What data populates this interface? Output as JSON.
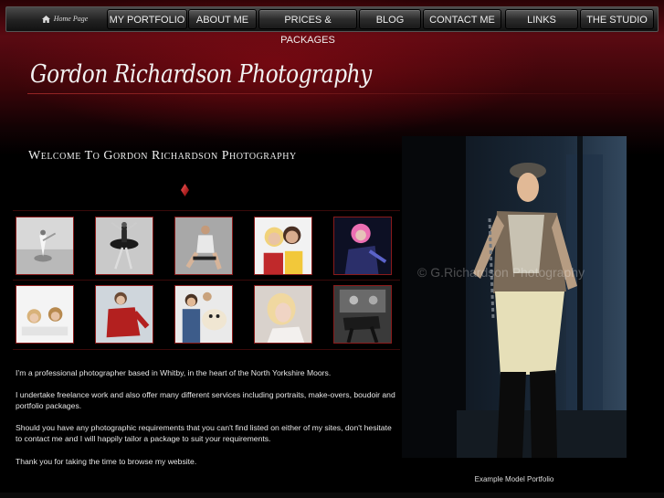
{
  "nav": {
    "home_label": "Home Page",
    "items": [
      {
        "label": "MY PORTFOLIO"
      },
      {
        "label": "ABOUT ME"
      },
      {
        "label": "PRICES & PACKAGES"
      },
      {
        "label": "BLOG"
      },
      {
        "label": "CONTACT ME"
      },
      {
        "label": "LINKS"
      },
      {
        "label": "THE STUDIO"
      }
    ]
  },
  "header": {
    "site_title": "Gordon Richardson Photography"
  },
  "main": {
    "welcome_heading": "Welcome To Gordon Richardson Photography",
    "thumbnails": [
      {
        "icon": "ballet-dancer-beach-photo"
      },
      {
        "icon": "ballerina-tutu-photo"
      },
      {
        "icon": "seated-model-photo"
      },
      {
        "icon": "two-blonde-women-photo"
      },
      {
        "icon": "pink-hair-model-photo"
      },
      {
        "icon": "two-girls-lying-photo"
      },
      {
        "icon": "red-jumper-model-photo"
      },
      {
        "icon": "couple-with-dog-photo"
      },
      {
        "icon": "blonde-portrait-photo"
      },
      {
        "icon": "mirror-boudoir-photo"
      }
    ],
    "paragraphs": [
      "I’m a professional photographer based in Whitby, in the heart of the North Yorkshire Moors.",
      "I undertake freelance work and also offer many different services including portraits, make-overs, boudoir and portfolio packages.",
      "Should you have any photographic requirements that you can't find listed on either of my sites, don't hesitate to contact me and I will happily tailor a package to suit your requirements.",
      "Thank you for taking the time to browse my website."
    ]
  },
  "feature": {
    "image_icon": "model-in-doorway-photo",
    "watermark": "© G.Richardson Photography",
    "caption": "Example Model Portfolio"
  },
  "colors": {
    "accent_red": "#8a1b1b",
    "nav_text": "#eeeeee",
    "background": "#000000"
  }
}
